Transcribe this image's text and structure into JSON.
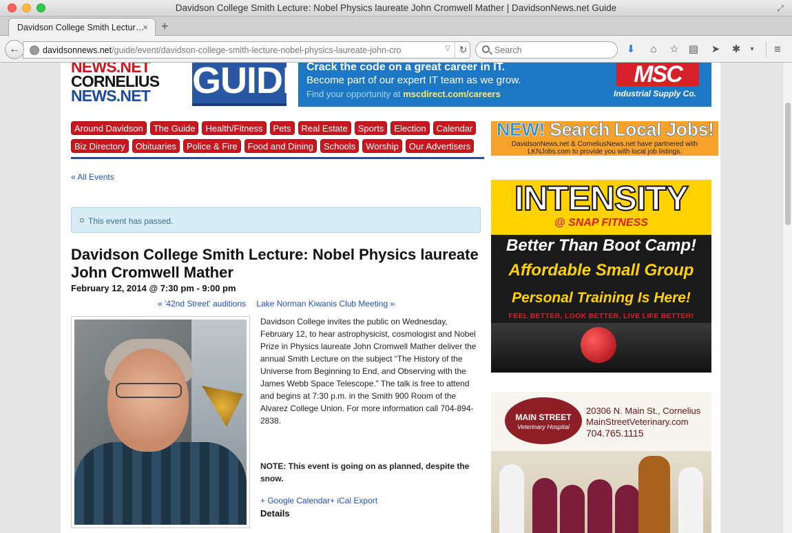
{
  "window": {
    "title": "Davidson College Smith Lecture: Nobel Physics laureate John Cromwell Mather | DavidsonNews.net Guide"
  },
  "tab": {
    "label": "Davidson College Smith Lectur…",
    "close": "×",
    "new": "+"
  },
  "nav": {
    "url_domain": "davidsonnews.net",
    "url_path": "/guide/event/davidson-college-smith-lecture-nobel-physics-laureate-john-cro",
    "search_placeholder": "Search"
  },
  "logo": {
    "line1": "NEWS.NET",
    "line2": "CORNELIUS",
    "line3": "NEWS.NET"
  },
  "guide_logo": "GUIDE",
  "msc_ad": {
    "line1": "Crack the code on a great career in IT.",
    "line2": "Become part of our expert IT team as we grow.",
    "line3_prefix": "Find your opportunity at ",
    "line3_link": "mscdirect.com/careers",
    "logo": "MSC",
    "sub": "Industrial Supply Co."
  },
  "categories": {
    "row1": [
      "Around Davidson",
      "The Guide",
      "Health/Fitness",
      "Pets",
      "Real Estate",
      "Sports",
      "Election",
      "Calendar"
    ],
    "row2": [
      "Biz Directory",
      "Obituaries",
      "Police & Fire",
      "Food and Dining",
      "Schools",
      "Worship",
      "Our Advertisers"
    ]
  },
  "jobs_ad": {
    "new": "NEW!",
    "title": " Search Local Jobs!",
    "line1": "DavidsonNews.net & CorneliusNews.net have partnered with",
    "line2": "LKNJobs.com to provide you with local job listings."
  },
  "content": {
    "all_events": "« All Events",
    "notice": "This event has passed.",
    "title": "Davidson College Smith Lecture: Nobel Physics laureate John Cromwell Mather",
    "date": "February 12, 2014 @ 7:30 pm - 9:00 pm",
    "prev_event": "« '42nd Street' auditions",
    "next_event": "Lake Norman Kiwanis Club Meeting »",
    "body": "Davidson College invites the public on Wednesday, February 12, to hear astrophysicist, cosmologist and Nobel Prize in Physics laureate John Cromwell Mather deliver the annual Smith Lecture on the subject “The History of the Universe from Beginning to End, and Observing with the James Webb Space Telescope.” The talk is free to attend and begins at 7:30 p.m. in the Smith 900 Room of the Alvarez College Union. For more information call 704-894-2838.",
    "note": "NOTE: This event is going on as planned, despite the snow.",
    "export": "+ Google Calendar+ iCal Export",
    "details": "Details"
  },
  "intensity_ad": {
    "title": "INTENSITY",
    "sub": "@ SNAP FITNESS",
    "line1": "Better Than Boot Camp!",
    "line2": "Affordable Small Group",
    "line3": "Personal Training Is Here!",
    "line4": "FEEL BETTER, LOOK BETTER, LIVE LIFE BETTER!"
  },
  "vet_ad": {
    "logo_line1": "MAIN STREET",
    "logo_line2": "Veterinary Hospital",
    "address": "20306 N. Main St., Cornelius",
    "site": "MainStreetVeterinary.com",
    "phone": "704.765.1115"
  }
}
